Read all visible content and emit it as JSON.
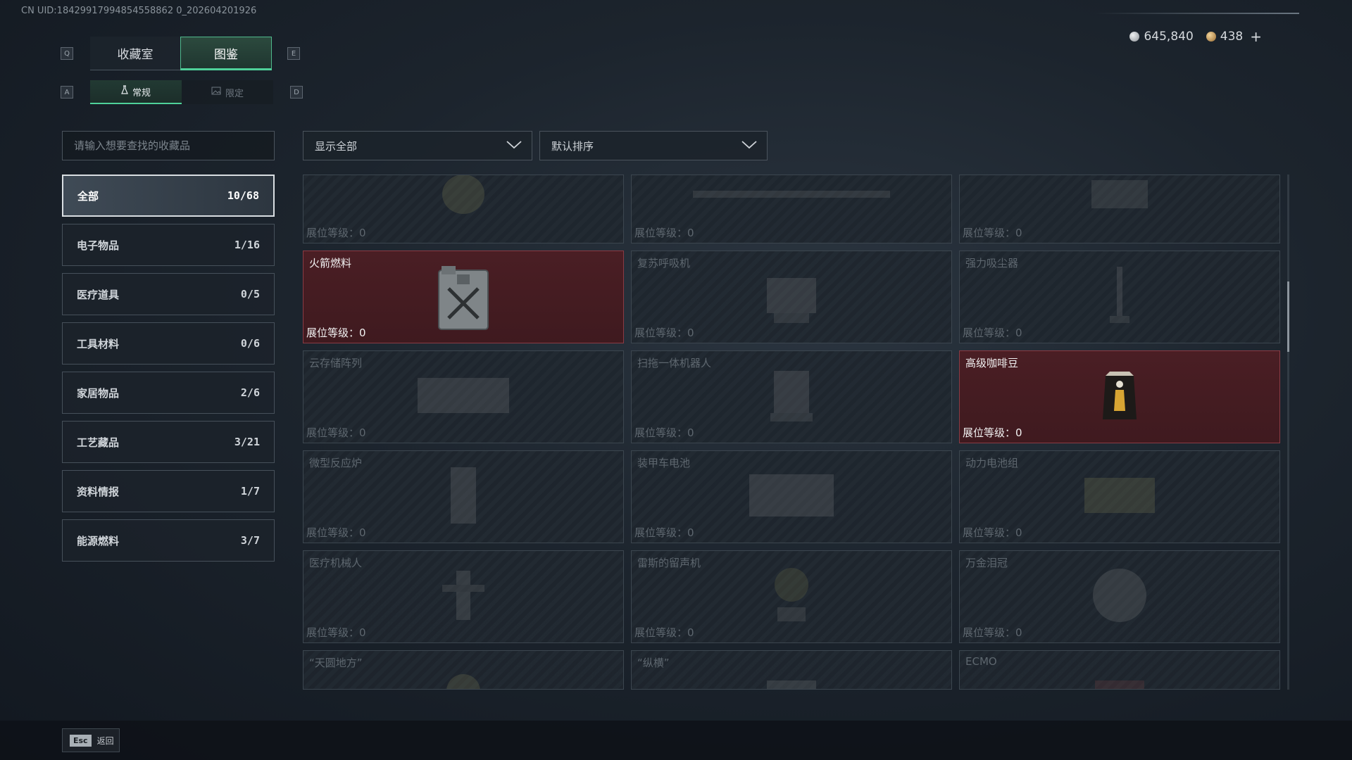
{
  "uid": "CN UID:18429917994854558862 0_202604201926",
  "keys": {
    "prev_tab": "Q",
    "next_tab": "E",
    "prev_sub": "A",
    "next_sub": "D"
  },
  "main_tabs": [
    {
      "label": "收藏室",
      "active": false
    },
    {
      "label": "图鉴",
      "active": true
    }
  ],
  "sub_tabs": [
    {
      "label": "常规",
      "icon": "flask-icon",
      "active": true
    },
    {
      "label": "限定",
      "icon": "image-icon",
      "active": false
    }
  ],
  "currency": {
    "silver": {
      "value": "645,840",
      "color": "#c0c4c8",
      "icon": "silver-coin-icon"
    },
    "gold": {
      "value": "438",
      "color": "#c89a5a",
      "icon": "gold-coin-icon"
    },
    "plus": "+"
  },
  "search": {
    "placeholder": "请输入想要查找的收藏品"
  },
  "categories": [
    {
      "label": "全部",
      "count": "10/68",
      "active": true
    },
    {
      "label": "电子物品",
      "count": "1/16",
      "active": false
    },
    {
      "label": "医疗道具",
      "count": "0/5",
      "active": false
    },
    {
      "label": "工具材料",
      "count": "0/6",
      "active": false
    },
    {
      "label": "家居物品",
      "count": "2/6",
      "active": false
    },
    {
      "label": "工艺藏品",
      "count": "3/21",
      "active": false
    },
    {
      "label": "资料情报",
      "count": "1/7",
      "active": false
    },
    {
      "label": "能源燃料",
      "count": "3/7",
      "active": false
    }
  ],
  "filters": {
    "show": "显示全部",
    "sort": "默认排序"
  },
  "level_label": "展位等级：",
  "items": [
    {
      "name": "",
      "level": "0",
      "owned": false,
      "icon": "tank-icon"
    },
    {
      "name": "",
      "level": "0",
      "owned": false,
      "icon": "rifle-icon"
    },
    {
      "name": "",
      "level": "0",
      "owned": false,
      "icon": "machine-icon"
    },
    {
      "name": "火箭燃料",
      "level": "0",
      "owned": true,
      "icon": "fuel-canister-icon"
    },
    {
      "name": "复苏呼吸机",
      "level": "0",
      "owned": false,
      "icon": "ventilator-icon"
    },
    {
      "name": "强力吸尘器",
      "level": "0",
      "owned": false,
      "icon": "vacuum-icon"
    },
    {
      "name": "云存储阵列",
      "level": "0",
      "owned": false,
      "icon": "storage-array-icon"
    },
    {
      "name": "扫拖一体机器人",
      "level": "0",
      "owned": false,
      "icon": "robot-icon"
    },
    {
      "name": "高级咖啡豆",
      "level": "0",
      "owned": true,
      "icon": "coffee-bag-icon"
    },
    {
      "name": "微型反应炉",
      "level": "0",
      "owned": false,
      "icon": "reactor-icon"
    },
    {
      "name": "装甲车电池",
      "level": "0",
      "owned": false,
      "icon": "battery-icon"
    },
    {
      "name": "动力电池组",
      "level": "0",
      "owned": false,
      "icon": "battery-pack-icon"
    },
    {
      "name": "医疗机械人",
      "level": "0",
      "owned": false,
      "icon": "medical-robot-icon"
    },
    {
      "name": "雷斯的留声机",
      "level": "0",
      "owned": false,
      "icon": "gramophone-icon"
    },
    {
      "name": "万金泪冠",
      "level": "0",
      "owned": false,
      "icon": "crown-icon"
    },
    {
      "name": "“天圆地方”",
      "level": "",
      "owned": false,
      "icon": "artifact-icon"
    },
    {
      "name": "“纵横”",
      "level": "",
      "owned": false,
      "icon": "artifact-icon"
    },
    {
      "name": "ECMO",
      "level": "",
      "owned": false,
      "icon": "ecmo-icon"
    }
  ],
  "footer": {
    "esc_key": "Esc",
    "esc_label": "返回"
  }
}
